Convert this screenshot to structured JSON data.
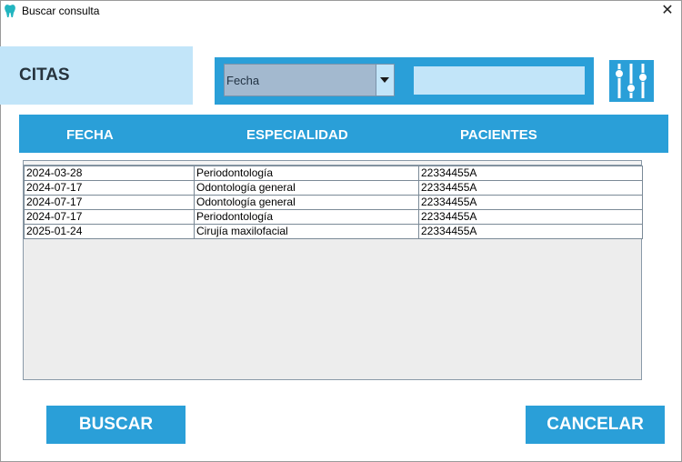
{
  "window": {
    "title": "Buscar consulta",
    "close_glyph": "✕"
  },
  "panel": {
    "label": "CITAS"
  },
  "filter": {
    "selected": "Fecha",
    "search_value": "",
    "filter_icon": "sliders-icon"
  },
  "columns": [
    "FECHA",
    "ESPECIALIDAD",
    "PACIENTES"
  ],
  "rows": [
    [
      "2024-03-28",
      "Periodontología",
      "22334455A"
    ],
    [
      "2024-07-17",
      "Odontología general",
      "22334455A"
    ],
    [
      "2024-07-17",
      "Odontología general",
      "22334455A"
    ],
    [
      "2024-07-17",
      "Periodontología",
      "22334455A"
    ],
    [
      "2025-01-24",
      "Cirujía maxilofacial",
      "22334455A"
    ]
  ],
  "buttons": {
    "search": "BUSCAR",
    "cancel": "CANCELAR"
  },
  "colors": {
    "accent": "#2a9fd8",
    "light_accent": "#c2e5f9",
    "combo_bg": "#a3b9cf",
    "table_bg": "#ededed"
  }
}
